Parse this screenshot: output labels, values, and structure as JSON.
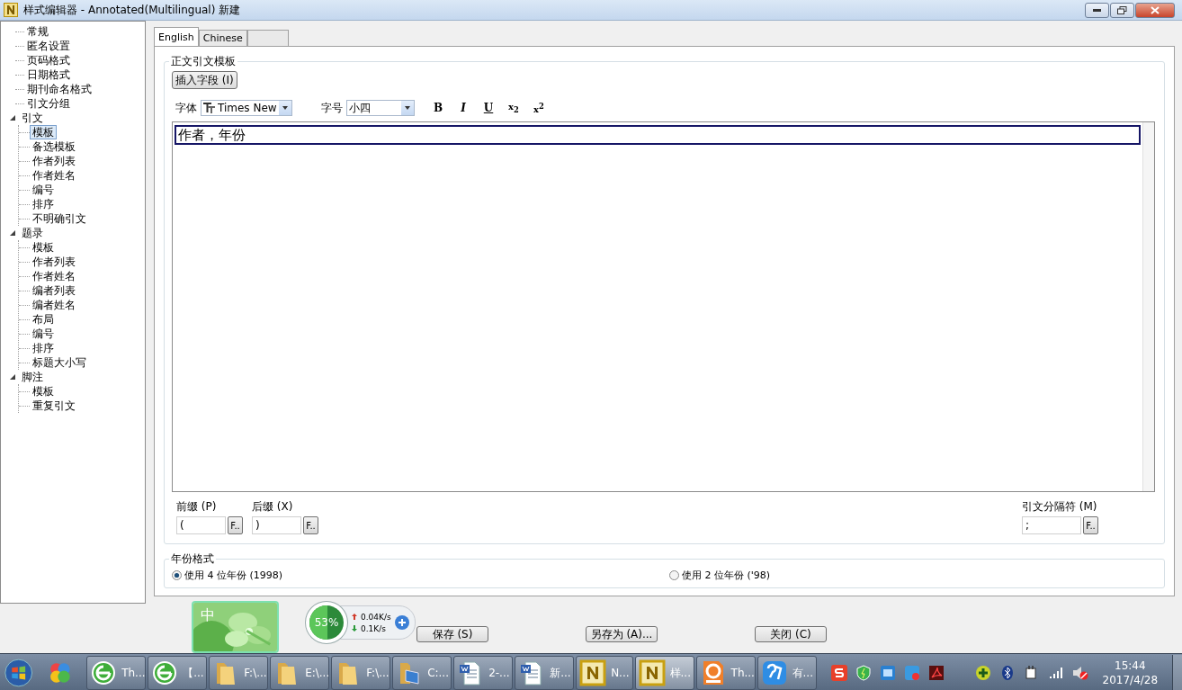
{
  "window": {
    "title": "样式编辑器 - Annotated(Multilingual) 新建"
  },
  "tree": [
    {
      "label": "常规",
      "selected": false
    },
    {
      "label": "匿名设置",
      "selected": false
    },
    {
      "label": "页码格式",
      "selected": false
    },
    {
      "label": "日期格式",
      "selected": false
    },
    {
      "label": "期刊命名格式",
      "selected": false
    },
    {
      "label": "引文分组",
      "selected": false
    },
    {
      "label": "引文",
      "selected": false,
      "expanded": true,
      "children": [
        {
          "label": "模板",
          "selected": true
        },
        {
          "label": "备选模板",
          "selected": false
        },
        {
          "label": "作者列表",
          "selected": false
        },
        {
          "label": "作者姓名",
          "selected": false
        },
        {
          "label": "编号",
          "selected": false
        },
        {
          "label": "排序",
          "selected": false
        },
        {
          "label": "不明确引文",
          "selected": false
        }
      ]
    },
    {
      "label": "题录",
      "selected": false,
      "expanded": true,
      "children": [
        {
          "label": "模板",
          "selected": false
        },
        {
          "label": "作者列表",
          "selected": false
        },
        {
          "label": "作者姓名",
          "selected": false
        },
        {
          "label": "编者列表",
          "selected": false
        },
        {
          "label": "编者姓名",
          "selected": false
        },
        {
          "label": "布局",
          "selected": false
        },
        {
          "label": "编号",
          "selected": false
        },
        {
          "label": "排序",
          "selected": false
        },
        {
          "label": "标题大小写",
          "selected": false
        }
      ]
    },
    {
      "label": "脚注",
      "selected": false,
      "expanded": true,
      "children": [
        {
          "label": "模板",
          "selected": false
        },
        {
          "label": "重复引文",
          "selected": false
        }
      ]
    }
  ],
  "tabs": [
    {
      "label": "English",
      "selected": true
    },
    {
      "label": "Chinese",
      "selected": false
    }
  ],
  "template_group": {
    "title": "正文引文模板",
    "insert_button": "插入字段 (I)",
    "font_label": "字体",
    "font_value": "Times New",
    "size_label": "字号",
    "size_value": "小四",
    "format_buttons": [
      {
        "kind": "bold",
        "label": "B"
      },
      {
        "kind": "italic",
        "label": "I"
      },
      {
        "kind": "underline",
        "label": "U"
      },
      {
        "kind": "subscript",
        "label": "x$_{2}$"
      },
      {
        "kind": "superscript",
        "label": "x$^{2}$"
      }
    ],
    "editor_text": "作者，年份",
    "prefix": {
      "label": "前缀 (P)",
      "value": "(",
      "button": "F.."
    },
    "suffix": {
      "label": "后缀 (X)",
      "value": ")",
      "button": "F.."
    },
    "separator": {
      "label": "引文分隔符 (M)",
      "value": ";",
      "button": "F.."
    }
  },
  "year_group": {
    "title": "年份格式",
    "options": [
      {
        "label": "使用 4 位年份 (1998)",
        "selected": true
      },
      {
        "label": "使用 2 位年份 ('98)",
        "selected": false
      }
    ]
  },
  "buttons": [
    "保存 (S)",
    "另存为 (A)...",
    "关闭 (C)"
  ],
  "ime_widget": {
    "label": "中"
  },
  "net_widget": {
    "reading": "53%",
    "level": 0.53,
    "upload": "0.04K/s",
    "download": "0.1K/s"
  },
  "taskbar": {
    "items": [
      {
        "kind": "browser",
        "label": "Th...",
        "selected": false
      },
      {
        "kind": "browser",
        "label": "【...",
        "selected": false
      },
      {
        "kind": "folder",
        "label": "F:\\...",
        "selected": false
      },
      {
        "kind": "folder",
        "label": "E:\\...",
        "selected": false
      },
      {
        "kind": "folder",
        "label": "F:\\...",
        "selected": false
      },
      {
        "kind": "computer",
        "label": "C:...",
        "selected": false
      },
      {
        "kind": "word",
        "label": "2-...",
        "selected": false
      },
      {
        "kind": "word",
        "label": "新...",
        "selected": false
      },
      {
        "kind": "note",
        "label": "N...",
        "selected": false
      },
      {
        "kind": "note",
        "label": "样...",
        "selected": true
      },
      {
        "kind": "pdf",
        "label": "Th...",
        "selected": false
      },
      {
        "kind": "chat",
        "label": "有...",
        "selected": false
      }
    ],
    "time": "15:44",
    "date": "2017/4/28"
  }
}
